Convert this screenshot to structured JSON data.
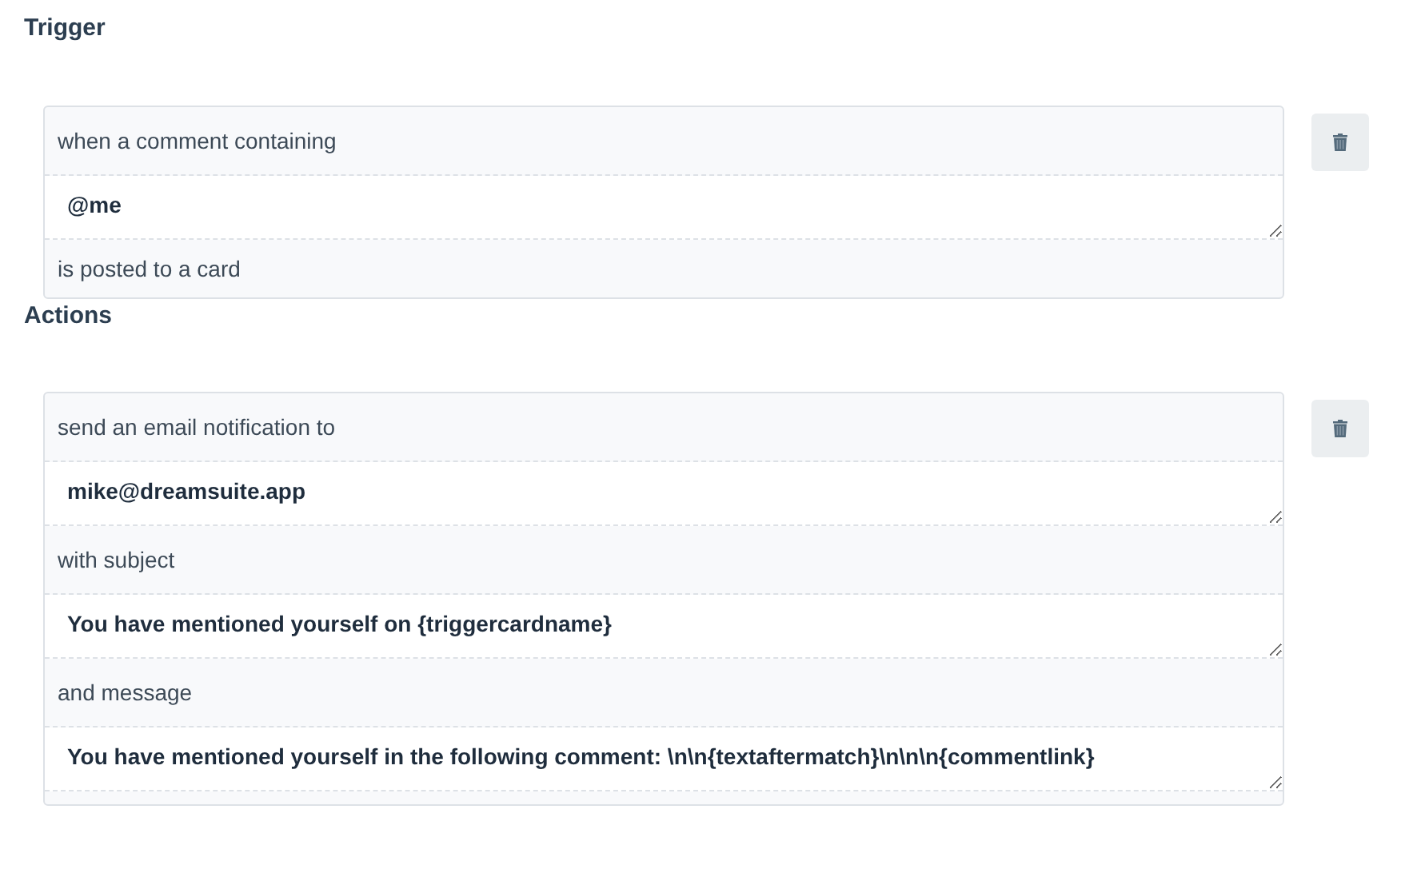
{
  "sections": [
    {
      "title": "Trigger",
      "rows": [
        {
          "kind": "label",
          "text": "when a comment containing"
        },
        {
          "kind": "field",
          "value": "@me"
        },
        {
          "kind": "label",
          "text": "is posted to a card"
        }
      ]
    },
    {
      "title": "Actions",
      "rows": [
        {
          "kind": "label",
          "text": "send an email notification to"
        },
        {
          "kind": "field",
          "value": "mike@dreamsuite.app"
        },
        {
          "kind": "label",
          "text": "with subject"
        },
        {
          "kind": "field",
          "value": "You have mentioned yourself on {triggercardname}"
        },
        {
          "kind": "label",
          "text": "and message"
        },
        {
          "kind": "field",
          "value": "You have mentioned yourself in the following comment: \\n\\n{textaftermatch}\\n\\n\\n{commentlink}"
        }
      ]
    }
  ]
}
